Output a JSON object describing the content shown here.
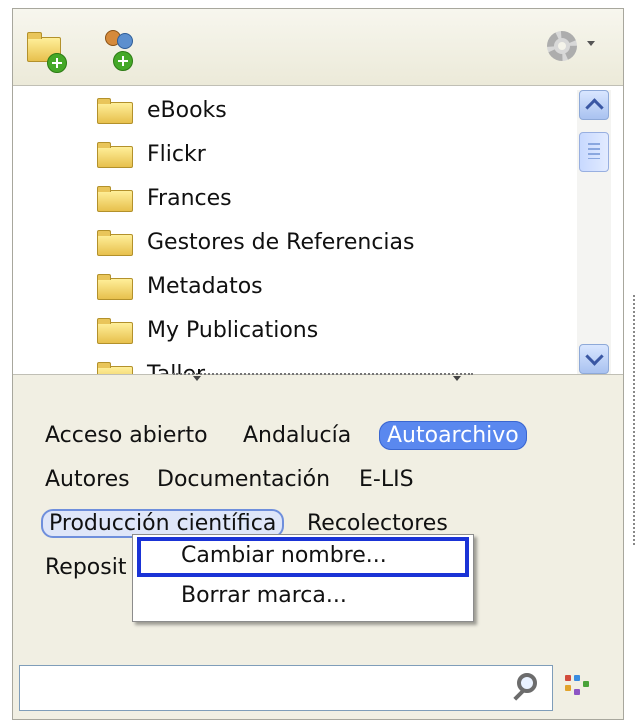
{
  "toolbar": {
    "new_folder_icon": "folder-add-icon",
    "share_icon": "group-add-icon",
    "settings_icon": "gear-icon"
  },
  "folders": [
    {
      "label": "eBooks"
    },
    {
      "label": "Flickr"
    },
    {
      "label": "Frances"
    },
    {
      "label": "Gestores de Referencias"
    },
    {
      "label": "Metadatos"
    },
    {
      "label": "My Publications"
    },
    {
      "label": "Taller"
    }
  ],
  "tags": [
    {
      "label": "Acceso abierto",
      "state": "normal"
    },
    {
      "label": "Andalucía",
      "state": "normal"
    },
    {
      "label": "Autoarchivo",
      "state": "selected"
    },
    {
      "label": "Autores",
      "state": "normal"
    },
    {
      "label": "Documentación",
      "state": "normal"
    },
    {
      "label": "E-LIS",
      "state": "normal"
    },
    {
      "label": "Producción científica",
      "state": "outlined"
    },
    {
      "label": "Recolectores",
      "state": "normal"
    },
    {
      "label": "Reposit",
      "state": "normal"
    }
  ],
  "context_menu": {
    "items": [
      {
        "label": "Cambiar nombre...",
        "highlighted": true
      },
      {
        "label": "Borrar marca..."
      }
    ]
  },
  "search": {
    "value": "",
    "placeholder": ""
  },
  "colors": {
    "selected_tag": "#5a88ef",
    "highlight_outline": "#1a33d6",
    "panel_bg": "#f1efe3"
  }
}
